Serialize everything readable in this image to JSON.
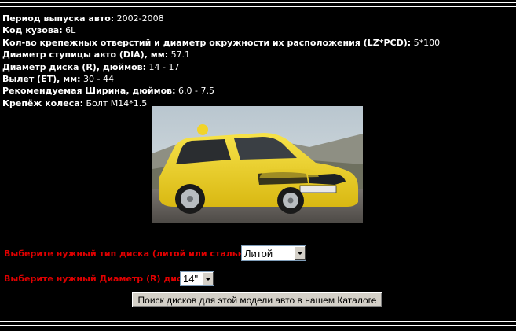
{
  "specs": [
    {
      "label": "Период выпуска авто:",
      "value": "2002-2008"
    },
    {
      "label": "Код кузова:",
      "value": "6L"
    },
    {
      "label": "Кол-во крепежных отверстий и диаметр окружности их расположения (LZ*PCD):",
      "value": "5*100"
    },
    {
      "label": "Диаметр ступицы авто (DIA), мм:",
      "value": "57.1"
    },
    {
      "label": "Диаметр диска (R), дюймов:",
      "value": "14 - 17"
    },
    {
      "label": "Вылет (ET), мм:",
      "value": "30 - 44"
    },
    {
      "label": "Рекомендуемая Ширина, дюймов:",
      "value": "6.0 - 7.5"
    },
    {
      "label": "Крепёж колеса:",
      "value": "Болт М14*1.5"
    }
  ],
  "form": {
    "disc_type_label": "Выберите нужный тип диска (литой или стальной):",
    "disc_type_value": "Литой",
    "diameter_label": "Выберите нужный Диаметр (R) диска:",
    "diameter_value": "14\"",
    "search_button": "Поиск дисков для этой модели авто в нашем Каталоге"
  },
  "colors": {
    "background": "#000000",
    "text": "#ffffff",
    "form_label": "#e00000",
    "car_body": "#f2d429"
  }
}
